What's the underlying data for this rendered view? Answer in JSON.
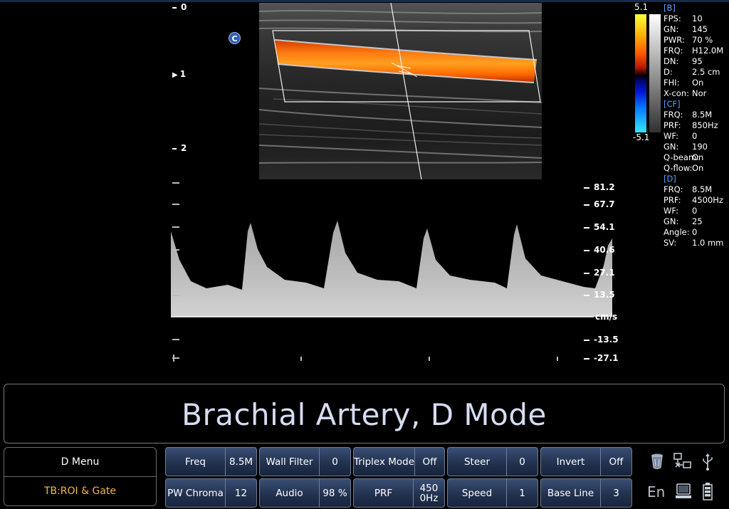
{
  "depth_scale": [
    "0",
    "1",
    "2"
  ],
  "color_marker": "C",
  "color_bar": {
    "max": "5.1",
    "min": "-5.1"
  },
  "params": [
    {
      "section": "[B]"
    },
    {
      "k": "FPS:",
      "v": "10"
    },
    {
      "k": "GN:",
      "v": "145"
    },
    {
      "k": "PWR:",
      "v": "70 %"
    },
    {
      "k": "FRQ:",
      "v": "H12.0M"
    },
    {
      "k": "DN:",
      "v": "95"
    },
    {
      "k": "D:",
      "v": "2.5 cm"
    },
    {
      "k": "FHI:",
      "v": "On"
    },
    {
      "k": "X-con:",
      "v": "Nor"
    },
    {
      "section": "[CF]"
    },
    {
      "k": "FRQ:",
      "v": "8.5M"
    },
    {
      "k": "PRF:",
      "v": "850Hz"
    },
    {
      "k": "WF:",
      "v": "0"
    },
    {
      "k": "GN:",
      "v": "190"
    },
    {
      "k": "Q-beam:",
      "v": "On"
    },
    {
      "k": "Q-flow:",
      "v": "On"
    },
    {
      "section": "[D]"
    },
    {
      "k": "FRQ:",
      "v": "8.5M"
    },
    {
      "k": "PRF:",
      "v": "4500Hz"
    },
    {
      "k": "WF:",
      "v": "0"
    },
    {
      "k": "GN:",
      "v": "25"
    },
    {
      "k": "Angle:",
      "v": "0"
    },
    {
      "k": "SV:",
      "v": "1.0 mm"
    }
  ],
  "velocity_scale": {
    "labels": [
      "81.2",
      "67.7",
      "54.1",
      "40.6",
      "27.1",
      "13.5",
      "cm/s",
      "-13.5",
      "-27.1"
    ]
  },
  "title": "Brachial Artery, D Mode",
  "menu": {
    "top": "D Menu",
    "bottom": "TB:ROI & Gate"
  },
  "softkeys": {
    "freq": {
      "label": "Freq",
      "value": "8.5M"
    },
    "wall_filter": {
      "label": "Wall Filter",
      "value": "0"
    },
    "triplex_mode": {
      "label": "Triplex Mode",
      "value": "Off"
    },
    "steer": {
      "label": "Steer",
      "value": "0"
    },
    "invert": {
      "label": "Invert",
      "value": "Off"
    },
    "pw_chroma": {
      "label": "PW Chroma",
      "value": "12"
    },
    "audio": {
      "label": "Audio",
      "value": "98 %"
    },
    "prf": {
      "label": "PRF",
      "value": "450\n0Hz"
    },
    "speed": {
      "label": "Speed",
      "value": "1"
    },
    "base_line": {
      "label": "Base Line",
      "value": "3"
    }
  },
  "status": {
    "language": "En"
  },
  "colors": {
    "title_text": "#d6ddf2",
    "menu_highlight": "#f2b84a",
    "section_header": "#5aa0ff"
  }
}
